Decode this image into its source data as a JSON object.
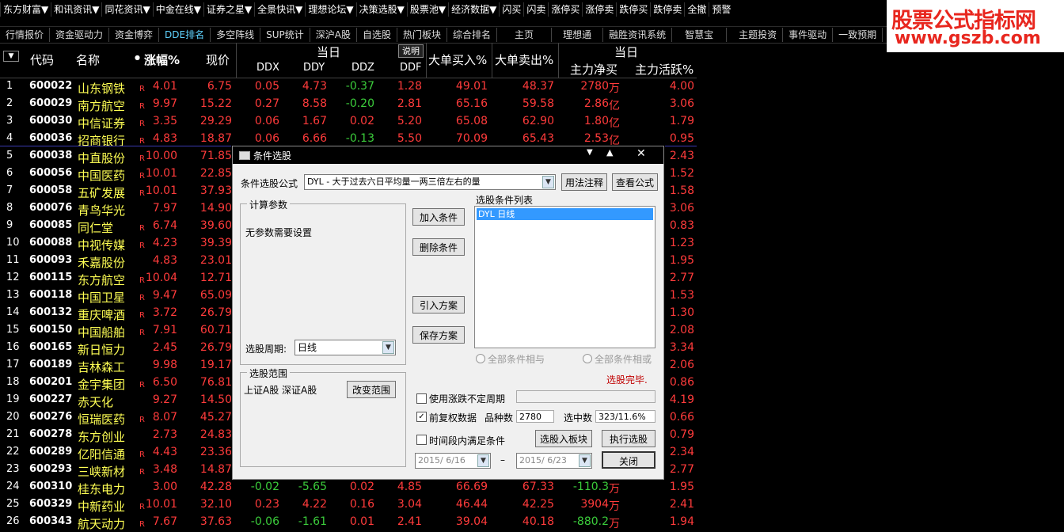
{
  "menu": {
    "items": [
      "东方财富▼",
      "和讯资讯▼",
      "同花资讯▼",
      "中金在线▼",
      "证券之星▼",
      "全景快讯▼",
      "理想论坛▼",
      "决策选股▼",
      "股票池▼",
      "经济数据▼",
      "闪买",
      "闪卖",
      "涨停买",
      "涨停卖",
      "跌停买",
      "跌停卖",
      "全撤",
      "预警"
    ]
  },
  "watermark": {
    "line1": "股票公式指标网",
    "line2": "www.gszb.com"
  },
  "tabs": [
    "行情报价",
    "资金驱动力",
    "资金博弈",
    "DDE排名",
    "多空阵线",
    "SUP统计",
    "深沪A股",
    "自选股",
    "热门板块",
    "综合排名",
    "主页",
    "理想通",
    "融胜资讯系统",
    "智慧宝",
    "主题投资",
    "事件驱动",
    "一致预期"
  ],
  "header": {
    "code": "代码",
    "name": "名称",
    "change": "涨幅%",
    "price": "现价",
    "group1": "当日",
    "ddx": "DDX",
    "ddy": "DDY",
    "ddz": "DDZ",
    "ddf": "DDF",
    "explain": "说明",
    "bigbuy": "大单买入%",
    "bigsell": "大单卖出%",
    "group2": "当日",
    "netflow": "主力净买",
    "active": "主力活跃%"
  },
  "rows": [
    {
      "i": "1",
      "code": "600022",
      "name": "山东钢铁",
      "r": "R",
      "chg": "4.01",
      "price": "6.75",
      "ddx": "0.05",
      "ddy": "4.73",
      "ddz": "-0.37",
      "ddf": "1.28",
      "buy": "49.01",
      "sell": "48.37",
      "net": "2780",
      "unit": "万",
      "act": "4.00"
    },
    {
      "i": "2",
      "code": "600029",
      "name": "南方航空",
      "r": "R",
      "chg": "9.97",
      "price": "15.22",
      "ddx": "0.27",
      "ddy": "8.58",
      "ddz": "-0.20",
      "ddf": "2.81",
      "buy": "65.16",
      "sell": "59.58",
      "net": "2.86",
      "unit": "亿",
      "act": "3.06"
    },
    {
      "i": "3",
      "code": "600030",
      "name": "中信证券",
      "r": "R",
      "chg": "3.35",
      "price": "29.29",
      "ddx": "0.06",
      "ddy": "1.67",
      "ddz": "0.02",
      "ddf": "5.20",
      "buy": "65.08",
      "sell": "62.90",
      "net": "1.80",
      "unit": "亿",
      "act": "1.79"
    },
    {
      "i": "4",
      "code": "600036",
      "name": "招商银行",
      "r": "R",
      "chg": "4.83",
      "price": "18.87",
      "ddx": "0.06",
      "ddy": "6.66",
      "ddz": "-0.13",
      "ddf": "5.50",
      "buy": "70.09",
      "sell": "65.43",
      "net": "2.53",
      "unit": "亿",
      "act": "0.95"
    },
    {
      "i": "5",
      "code": "600038",
      "name": "中直股份",
      "r": "R",
      "chg": "10.00",
      "price": "71.85",
      "ddx": "",
      "ddy": "",
      "ddz": "",
      "ddf": "",
      "buy": "",
      "sell": "",
      "net": "",
      "unit": "",
      "act": "2.43"
    },
    {
      "i": "6",
      "code": "600056",
      "name": "中国医药",
      "r": "R",
      "chg": "10.01",
      "price": "22.85",
      "ddx": "",
      "ddy": "",
      "ddz": "",
      "ddf": "",
      "buy": "",
      "sell": "",
      "net": "",
      "unit": "",
      "act": "1.52"
    },
    {
      "i": "7",
      "code": "600058",
      "name": "五矿发展",
      "r": "R",
      "chg": "10.01",
      "price": "37.93",
      "ddx": "",
      "ddy": "",
      "ddz": "",
      "ddf": "",
      "buy": "",
      "sell": "",
      "net": "",
      "unit": "",
      "act": "1.58"
    },
    {
      "i": "8",
      "code": "600076",
      "name": "青鸟华光",
      "r": "",
      "chg": "7.97",
      "price": "14.90",
      "ddx": "",
      "ddy": "",
      "ddz": "",
      "ddf": "",
      "buy": "",
      "sell": "",
      "net": "",
      "unit": "",
      "act": "3.06"
    },
    {
      "i": "9",
      "code": "600085",
      "name": "同仁堂",
      "r": "R",
      "chg": "6.74",
      "price": "39.60",
      "ddx": "",
      "ddy": "",
      "ddz": "",
      "ddf": "",
      "buy": "",
      "sell": "",
      "net": "",
      "unit": "",
      "act": "0.83"
    },
    {
      "i": "10",
      "code": "600088",
      "name": "中视传媒",
      "r": "R",
      "chg": "4.23",
      "price": "39.39",
      "ddx": "",
      "ddy": "",
      "ddz": "",
      "ddf": "",
      "buy": "",
      "sell": "",
      "net": "",
      "unit": "",
      "act": "1.23"
    },
    {
      "i": "11",
      "code": "600093",
      "name": "禾嘉股份",
      "r": "",
      "chg": "4.83",
      "price": "23.01",
      "ddx": "",
      "ddy": "",
      "ddz": "",
      "ddf": "",
      "buy": "",
      "sell": "",
      "net": "",
      "unit": "",
      "act": "1.95"
    },
    {
      "i": "12",
      "code": "600115",
      "name": "东方航空",
      "r": "R",
      "chg": "10.04",
      "price": "12.71",
      "ddx": "",
      "ddy": "",
      "ddz": "",
      "ddf": "",
      "buy": "",
      "sell": "",
      "net": "",
      "unit": "",
      "act": "2.77"
    },
    {
      "i": "13",
      "code": "600118",
      "name": "中国卫星",
      "r": "R",
      "chg": "9.47",
      "price": "65.09",
      "ddx": "",
      "ddy": "",
      "ddz": "",
      "ddf": "",
      "buy": "",
      "sell": "",
      "net": "",
      "unit": "",
      "act": "1.53"
    },
    {
      "i": "14",
      "code": "600132",
      "name": "重庆啤酒",
      "r": "R",
      "chg": "3.72",
      "price": "26.79",
      "ddx": "",
      "ddy": "",
      "ddz": "",
      "ddf": "",
      "buy": "",
      "sell": "",
      "net": "",
      "unit": "",
      "act": "1.30"
    },
    {
      "i": "15",
      "code": "600150",
      "name": "中国船舶",
      "r": "R",
      "chg": "7.91",
      "price": "60.71",
      "ddx": "",
      "ddy": "",
      "ddz": "",
      "ddf": "",
      "buy": "",
      "sell": "",
      "net": "",
      "unit": "",
      "act": "2.08"
    },
    {
      "i": "16",
      "code": "600165",
      "name": "新日恒力",
      "r": "",
      "chg": "2.45",
      "price": "26.79",
      "ddx": "",
      "ddy": "",
      "ddz": "",
      "ddf": "",
      "buy": "",
      "sell": "",
      "net": "",
      "unit": "",
      "act": "3.34"
    },
    {
      "i": "17",
      "code": "600189",
      "name": "吉林森工",
      "r": "",
      "chg": "9.98",
      "price": "19.17",
      "ddx": "",
      "ddy": "",
      "ddz": "",
      "ddf": "",
      "buy": "",
      "sell": "",
      "net": "",
      "unit": "",
      "act": "2.06"
    },
    {
      "i": "18",
      "code": "600201",
      "name": "金宇集团",
      "r": "R",
      "chg": "6.50",
      "price": "76.81",
      "ddx": "",
      "ddy": "",
      "ddz": "",
      "ddf": "",
      "buy": "",
      "sell": "",
      "net": "",
      "unit": "",
      "act": "0.86"
    },
    {
      "i": "19",
      "code": "600227",
      "name": "赤天化",
      "r": "",
      "chg": "9.27",
      "price": "14.50",
      "ddx": "",
      "ddy": "",
      "ddz": "",
      "ddf": "",
      "buy": "",
      "sell": "",
      "net": "",
      "unit": "",
      "act": "4.19"
    },
    {
      "i": "20",
      "code": "600276",
      "name": "恒瑞医药",
      "r": "R",
      "chg": "8.07",
      "price": "45.27",
      "ddx": "",
      "ddy": "",
      "ddz": "",
      "ddf": "",
      "buy": "",
      "sell": "",
      "net": "",
      "unit": "",
      "act": "0.66"
    },
    {
      "i": "21",
      "code": "600278",
      "name": "东方创业",
      "r": "",
      "chg": "2.73",
      "price": "24.83",
      "ddx": "",
      "ddy": "",
      "ddz": "",
      "ddf": "",
      "buy": "",
      "sell": "",
      "net": "",
      "unit": "",
      "act": "0.79"
    },
    {
      "i": "22",
      "code": "600289",
      "name": "亿阳信通",
      "r": "R",
      "chg": "4.43",
      "price": "23.36",
      "ddx": "",
      "ddy": "",
      "ddz": "",
      "ddf": "",
      "buy": "",
      "sell": "",
      "net": "",
      "unit": "",
      "act": "2.34"
    },
    {
      "i": "23",
      "code": "600293",
      "name": "三峡新材",
      "r": "R",
      "chg": "3.48",
      "price": "14.87",
      "ddx": "",
      "ddy": "",
      "ddz": "",
      "ddf": "",
      "buy": "",
      "sell": "",
      "net": "",
      "unit": "",
      "act": "2.77"
    },
    {
      "i": "24",
      "code": "600310",
      "name": "桂东电力",
      "r": "",
      "chg": "3.00",
      "price": "42.28",
      "ddx": "-0.02",
      "ddy": "-5.65",
      "ddz": "0.02",
      "ddf": "4.85",
      "buy": "66.69",
      "sell": "67.33",
      "net": "-110.3",
      "unit": "万",
      "act": "1.95"
    },
    {
      "i": "25",
      "code": "600329",
      "name": "中新药业",
      "r": "R",
      "chg": "10.01",
      "price": "32.10",
      "ddx": "0.23",
      "ddy": "4.22",
      "ddz": "0.16",
      "ddf": "3.04",
      "buy": "46.44",
      "sell": "42.25",
      "net": "3904",
      "unit": "万",
      "act": "2.41"
    },
    {
      "i": "26",
      "code": "600343",
      "name": "航天动力",
      "r": "R",
      "chg": "7.67",
      "price": "37.63",
      "ddx": "-0.06",
      "ddy": "-1.61",
      "ddz": "0.01",
      "ddf": "2.41",
      "buy": "39.04",
      "sell": "40.18",
      "net": "-880.2",
      "unit": "万",
      "act": "1.94"
    }
  ],
  "dialog": {
    "title": "条件选股",
    "formula_label": "条件选股公式",
    "formula_value": "DYL        - 大于过去六日平均量一两三倍左右的量",
    "usage_btn": "用法注释",
    "view_btn": "查看公式",
    "params_group": "计算参数",
    "params_text": "无参数需要设置",
    "add_btn": "加入条件",
    "delete_btn": "删除条件",
    "import_btn": "引入方案",
    "save_btn": "保存方案",
    "list_label": "选股条件列表",
    "list_items": [
      "DYL  日线"
    ],
    "period_label": "选股周期:",
    "period_value": "日线",
    "radio_and": "全部条件相与",
    "radio_or": "全部条件相或",
    "done_text": "选股完毕.",
    "scope_group": "选股范围",
    "scope_text": "上证A股 深证A股",
    "change_scope_btn": "改变范围",
    "chk_uncertain": "使用涨跌不定周期",
    "chk_adjust": "前复权数据",
    "count_label": "品种数",
    "count_value": "2780",
    "selected_label": "选中数",
    "selected_value": "323/11.6%",
    "chk_time": "时间段内满足条件",
    "to_block_btn": "选股入板块",
    "run_btn": "执行选股",
    "date_from": "2015/ 6/16",
    "date_sep": "–",
    "date_to": "2015/ 6/23",
    "close_btn": "关闭"
  }
}
